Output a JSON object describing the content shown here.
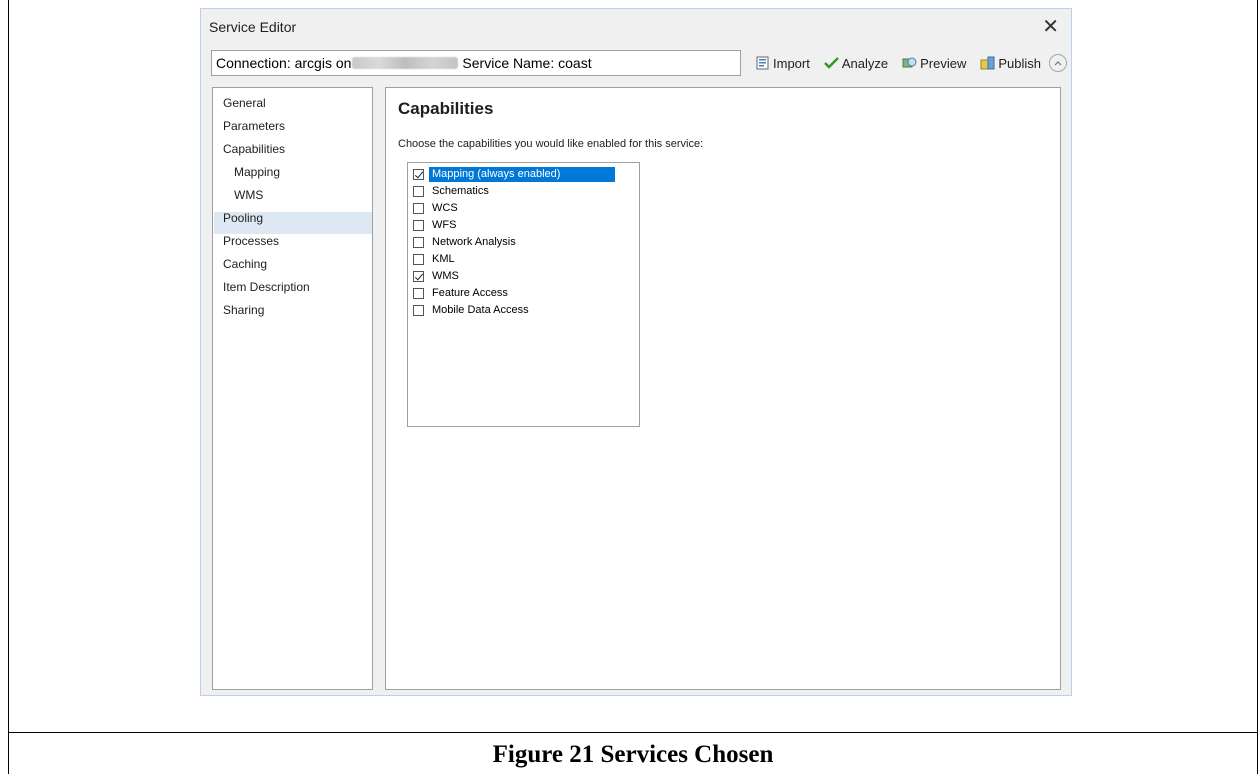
{
  "window": {
    "title": "Service Editor",
    "close_glyph": "✕"
  },
  "connection": {
    "prefix": "Connection: arcgis on",
    "service_label": "Service Name: coast"
  },
  "toolbar": {
    "import": "Import",
    "analyze": "Analyze",
    "preview": "Preview",
    "publish": "Publish"
  },
  "nav": {
    "items": [
      "General",
      "Parameters",
      "Capabilities",
      "Mapping",
      "WMS",
      "Pooling",
      "Processes",
      "Caching",
      "Item Description",
      "Sharing"
    ],
    "selected": "Capabilities"
  },
  "panel": {
    "title": "Capabilities",
    "description": "Choose the capabilities you would like enabled for this service:",
    "capabilities": [
      {
        "label": "Mapping (always enabled)",
        "checked": true,
        "selected": true
      },
      {
        "label": "Schematics",
        "checked": false
      },
      {
        "label": "WCS",
        "checked": false
      },
      {
        "label": "WFS",
        "checked": false
      },
      {
        "label": "Network Analysis",
        "checked": false
      },
      {
        "label": "KML",
        "checked": false
      },
      {
        "label": "WMS",
        "checked": true
      },
      {
        "label": "Feature Access",
        "checked": false
      },
      {
        "label": "Mobile Data Access",
        "checked": false
      }
    ]
  },
  "caption": "Figure 21 Services Chosen",
  "colors": {
    "selection": "#0078d7",
    "nav_selection": "#dde8f3",
    "window_bg": "#f0f0f0"
  }
}
